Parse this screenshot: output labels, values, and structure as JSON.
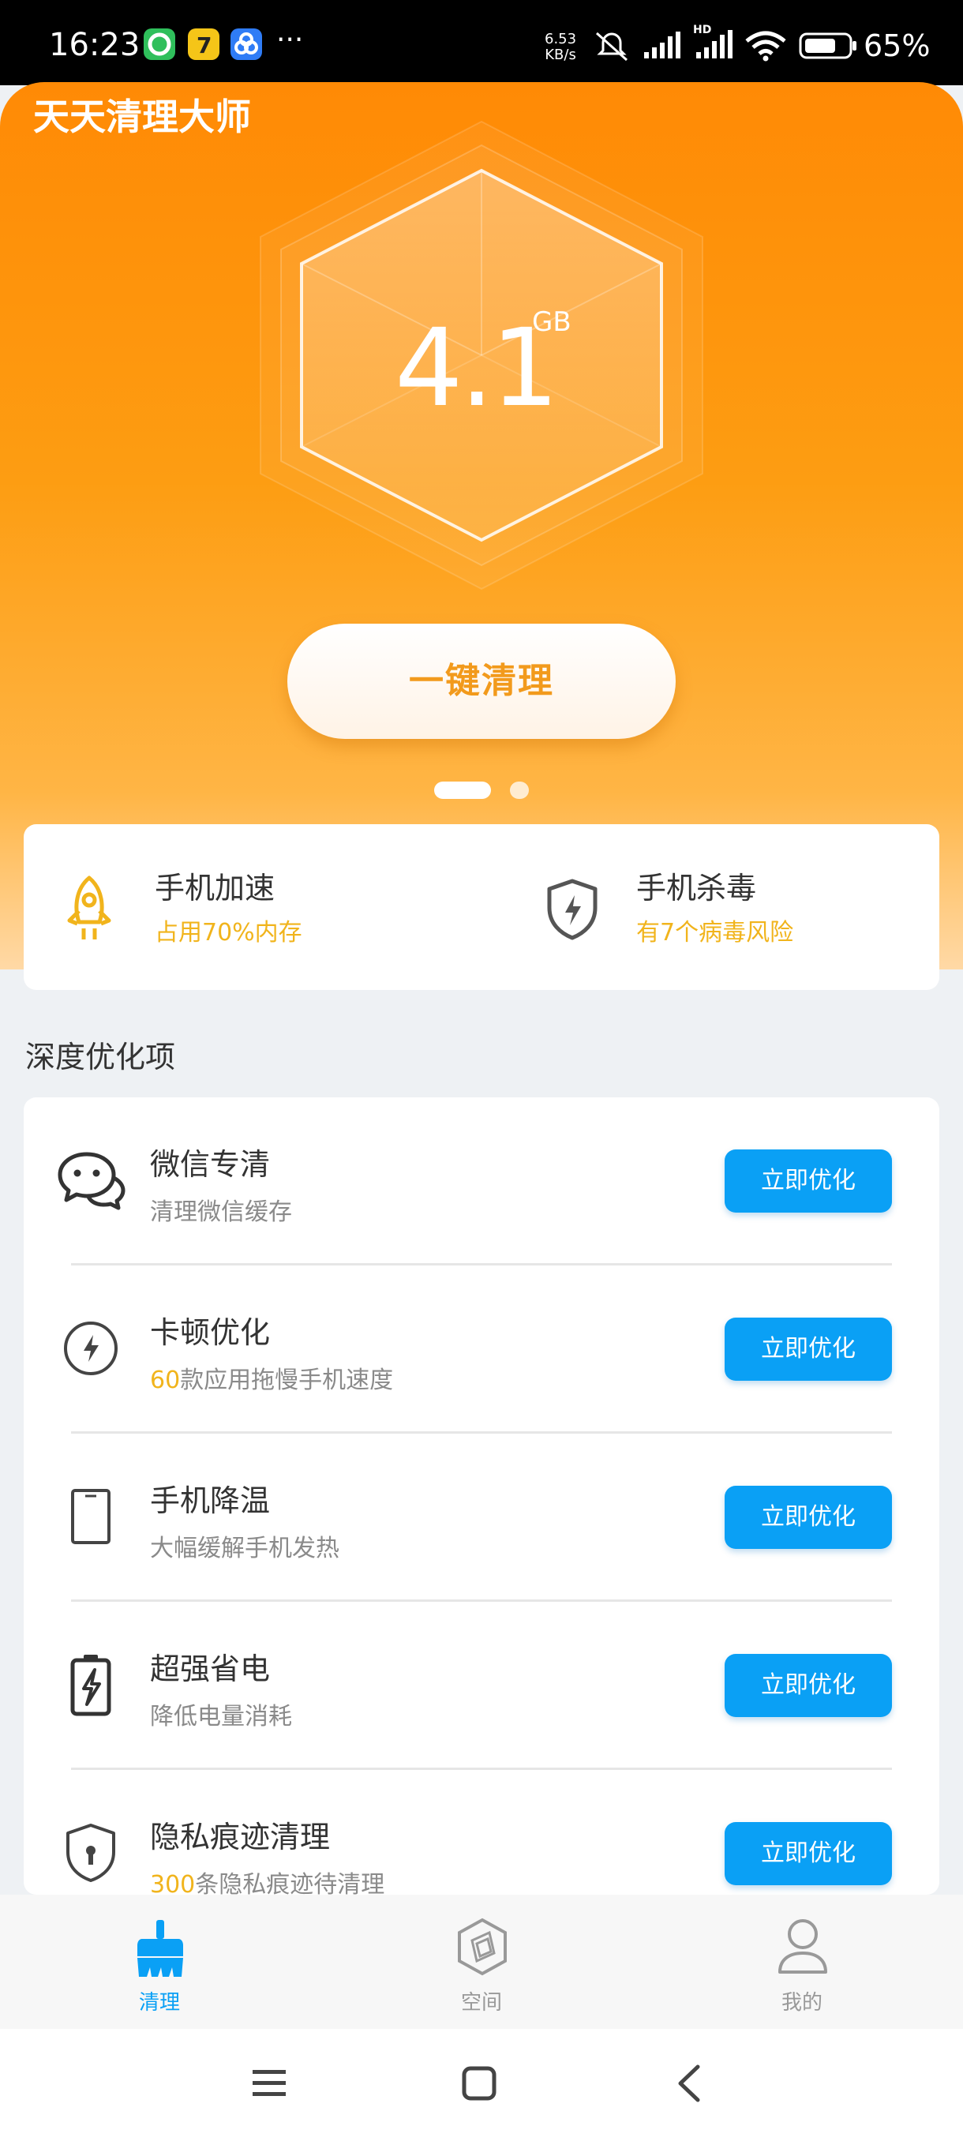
{
  "status_bar": {
    "time": "16:23",
    "dots": "···",
    "net_speed_value": "6.53",
    "net_speed_unit": "KB/s",
    "battery_percent": "65%",
    "network_label": "HD"
  },
  "header": {
    "app_title": "天天清理大师",
    "gauge_value": "4.1",
    "gauge_unit": "GB",
    "clean_button": "一键清理"
  },
  "quick_actions": [
    {
      "title": "手机加速",
      "subtitle": "占用70%内存",
      "icon": "rocket-icon"
    },
    {
      "title": "手机杀毒",
      "subtitle": "有7个病毒风险",
      "icon": "shield-bolt-icon"
    }
  ],
  "section_title": "深度优化项",
  "optimizations": [
    {
      "title": "微信专清",
      "sub_highlight": "",
      "sub_text": "清理微信缓存",
      "button": "立即优化",
      "icon": "wechat-icon"
    },
    {
      "title": "卡顿优化",
      "sub_highlight": "60",
      "sub_text": "款应用拖慢手机速度",
      "button": "立即优化",
      "icon": "lightning-icon"
    },
    {
      "title": "手机降温",
      "sub_highlight": "",
      "sub_text": "大幅缓解手机发热",
      "button": "立即优化",
      "icon": "phone-icon"
    },
    {
      "title": "超强省电",
      "sub_highlight": "",
      "sub_text": "降低电量消耗",
      "button": "立即优化",
      "icon": "battery-icon"
    },
    {
      "title": "隐私痕迹清理",
      "sub_highlight": "300",
      "sub_text": "条隐私痕迹待清理",
      "button": "立即优化",
      "icon": "privacy-shield-icon"
    }
  ],
  "tabs": [
    {
      "label": "清理",
      "active": true,
      "icon": "broom-icon"
    },
    {
      "label": "空间",
      "active": false,
      "icon": "storage-icon"
    },
    {
      "label": "我的",
      "active": false,
      "icon": "user-icon"
    }
  ],
  "colors": {
    "accent_blue": "#0aa0f5",
    "header_orange": "#ff8a05",
    "highlight_yellow": "#f1b41c"
  },
  "carousel": {
    "total_pages": 2,
    "current_page": 1
  }
}
